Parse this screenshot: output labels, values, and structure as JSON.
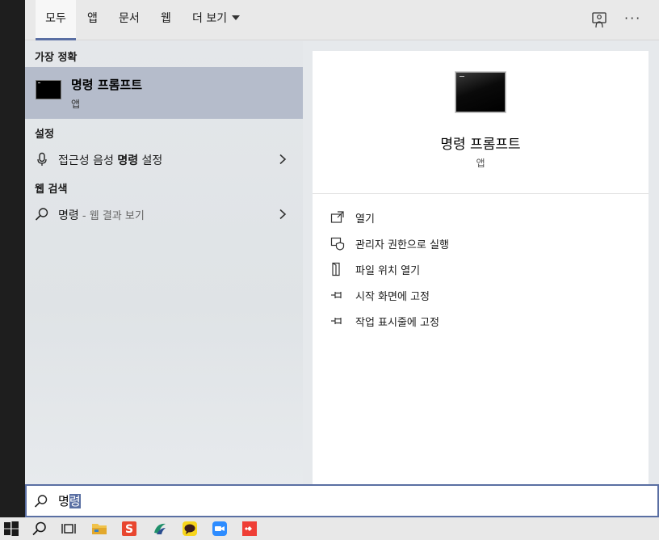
{
  "tabs": {
    "all": "모두",
    "apps": "앱",
    "documents": "문서",
    "web": "웹",
    "more": "더 보기"
  },
  "sections": {
    "best_match": "가장 정확",
    "settings": "설정",
    "web_search": "웹 검색"
  },
  "best_match": {
    "title": "명령 프롬프트",
    "subtitle": "앱"
  },
  "settings_result": {
    "prefix": "접근성 음성 ",
    "bold": "명령",
    "suffix": " 설정"
  },
  "web_result": {
    "query": "명령",
    "suffix": " - 웹 결과 보기"
  },
  "preview": {
    "title": "명령 프롬프트",
    "subtitle": "앱",
    "actions": [
      {
        "label": "열기",
        "icon": "open-icon"
      },
      {
        "label": "관리자 권한으로 실행",
        "icon": "shield-icon"
      },
      {
        "label": "파일 위치 열기",
        "icon": "file-location-icon"
      },
      {
        "label": "시작 화면에 고정",
        "icon": "pin-icon"
      },
      {
        "label": "작업 표시줄에 고정",
        "icon": "pin-icon"
      }
    ]
  },
  "search": {
    "typed": "명",
    "selected": "령"
  },
  "taskbar": {
    "items": [
      "windows-start-icon",
      "search-icon",
      "task-view-icon",
      "file-explorer-icon",
      "app-s-icon",
      "app-swirl-icon",
      "kakaotalk-icon",
      "zoom-icon",
      "anydesk-icon"
    ]
  },
  "colors": {
    "accent": "#5a6fa3",
    "best_match_bg": "#b5bccb",
    "panel_bg": "#e6e9ec"
  }
}
